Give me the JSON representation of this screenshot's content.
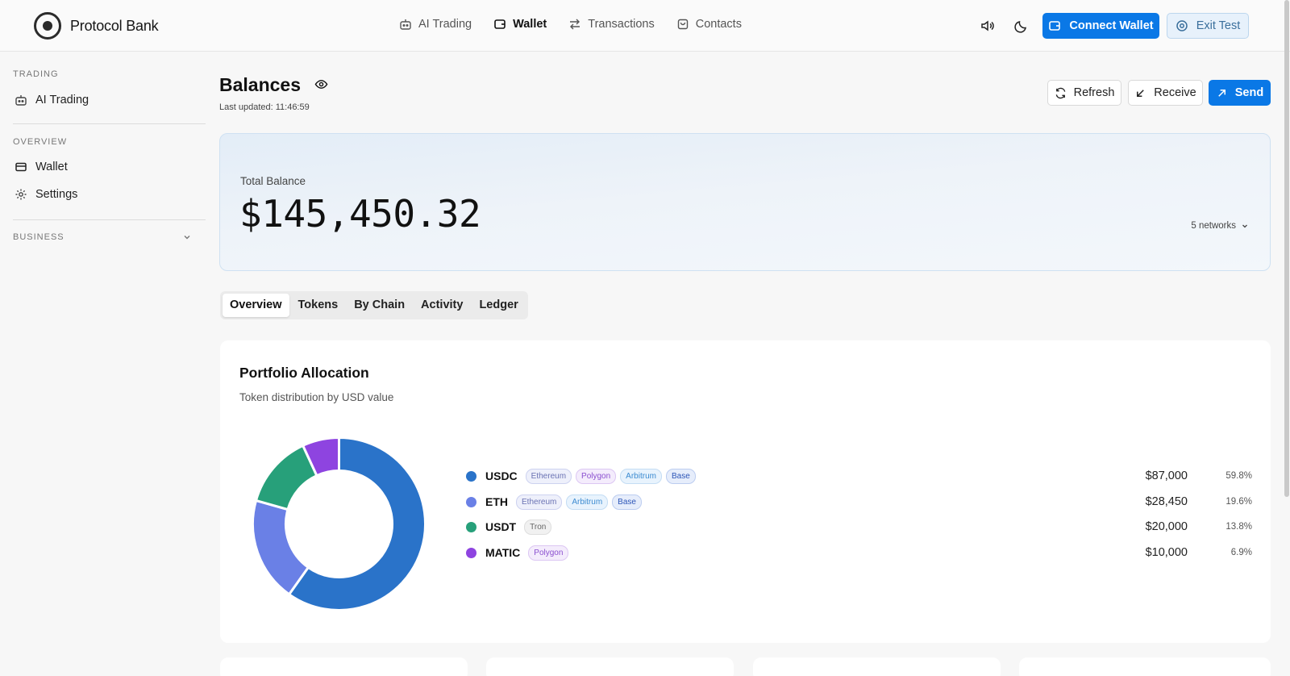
{
  "brand": {
    "name": "Protocol Bank"
  },
  "nav": [
    {
      "label": "AI Trading",
      "icon": "robot-icon"
    },
    {
      "label": "Wallet",
      "icon": "wallet-icon"
    },
    {
      "label": "Transactions",
      "icon": "arrows-icon"
    },
    {
      "label": "Contacts",
      "icon": "contacts-icon"
    }
  ],
  "topbar": {
    "connect_label": "Connect Wallet",
    "exit_label": "Exit Test",
    "accent": "#0a78e6"
  },
  "sidebar": {
    "trading_header": "TRADING",
    "ai_trading": "AI Trading",
    "overview_header": "OVERVIEW",
    "wallet": "Wallet",
    "settings": "Settings",
    "business_header": "BUSINESS"
  },
  "header": {
    "title": "Balances",
    "last_updated": "Last updated: 11:46:59",
    "refresh": "Refresh",
    "receive": "Receive",
    "send": "Send"
  },
  "balance": {
    "label": "Total Balance",
    "value": "$145,450.32",
    "networks": "5 networks"
  },
  "tabs": [
    "Overview",
    "Tokens",
    "By Chain",
    "Activity",
    "Ledger"
  ],
  "allocation": {
    "title": "Portfolio Allocation",
    "subtitle": "Token distribution by USD value",
    "tokens": [
      {
        "symbol": "USDC",
        "chains": [
          "Ethereum",
          "Polygon",
          "Arbitrum",
          "Base"
        ],
        "amount": "$87,000",
        "pct": "59.8%",
        "color": "#2a73c9"
      },
      {
        "symbol": "ETH",
        "chains": [
          "Ethereum",
          "Arbitrum",
          "Base"
        ],
        "amount": "$28,450",
        "pct": "19.6%",
        "color": "#6a80e6"
      },
      {
        "symbol": "USDT",
        "chains": [
          "Tron"
        ],
        "amount": "$20,000",
        "pct": "13.8%",
        "color": "#27a07a"
      },
      {
        "symbol": "MATIC",
        "chains": [
          "Polygon"
        ],
        "amount": "$10,000",
        "pct": "6.9%",
        "color": "#8e44e0"
      }
    ]
  },
  "chart_data": {
    "type": "pie",
    "categories": [
      "USDC",
      "ETH",
      "USDT",
      "MATIC"
    ],
    "values": [
      87000,
      28450,
      20000,
      10000
    ],
    "colors": [
      "#2a73c9",
      "#6a80e6",
      "#27a07a",
      "#8e44e0"
    ]
  }
}
